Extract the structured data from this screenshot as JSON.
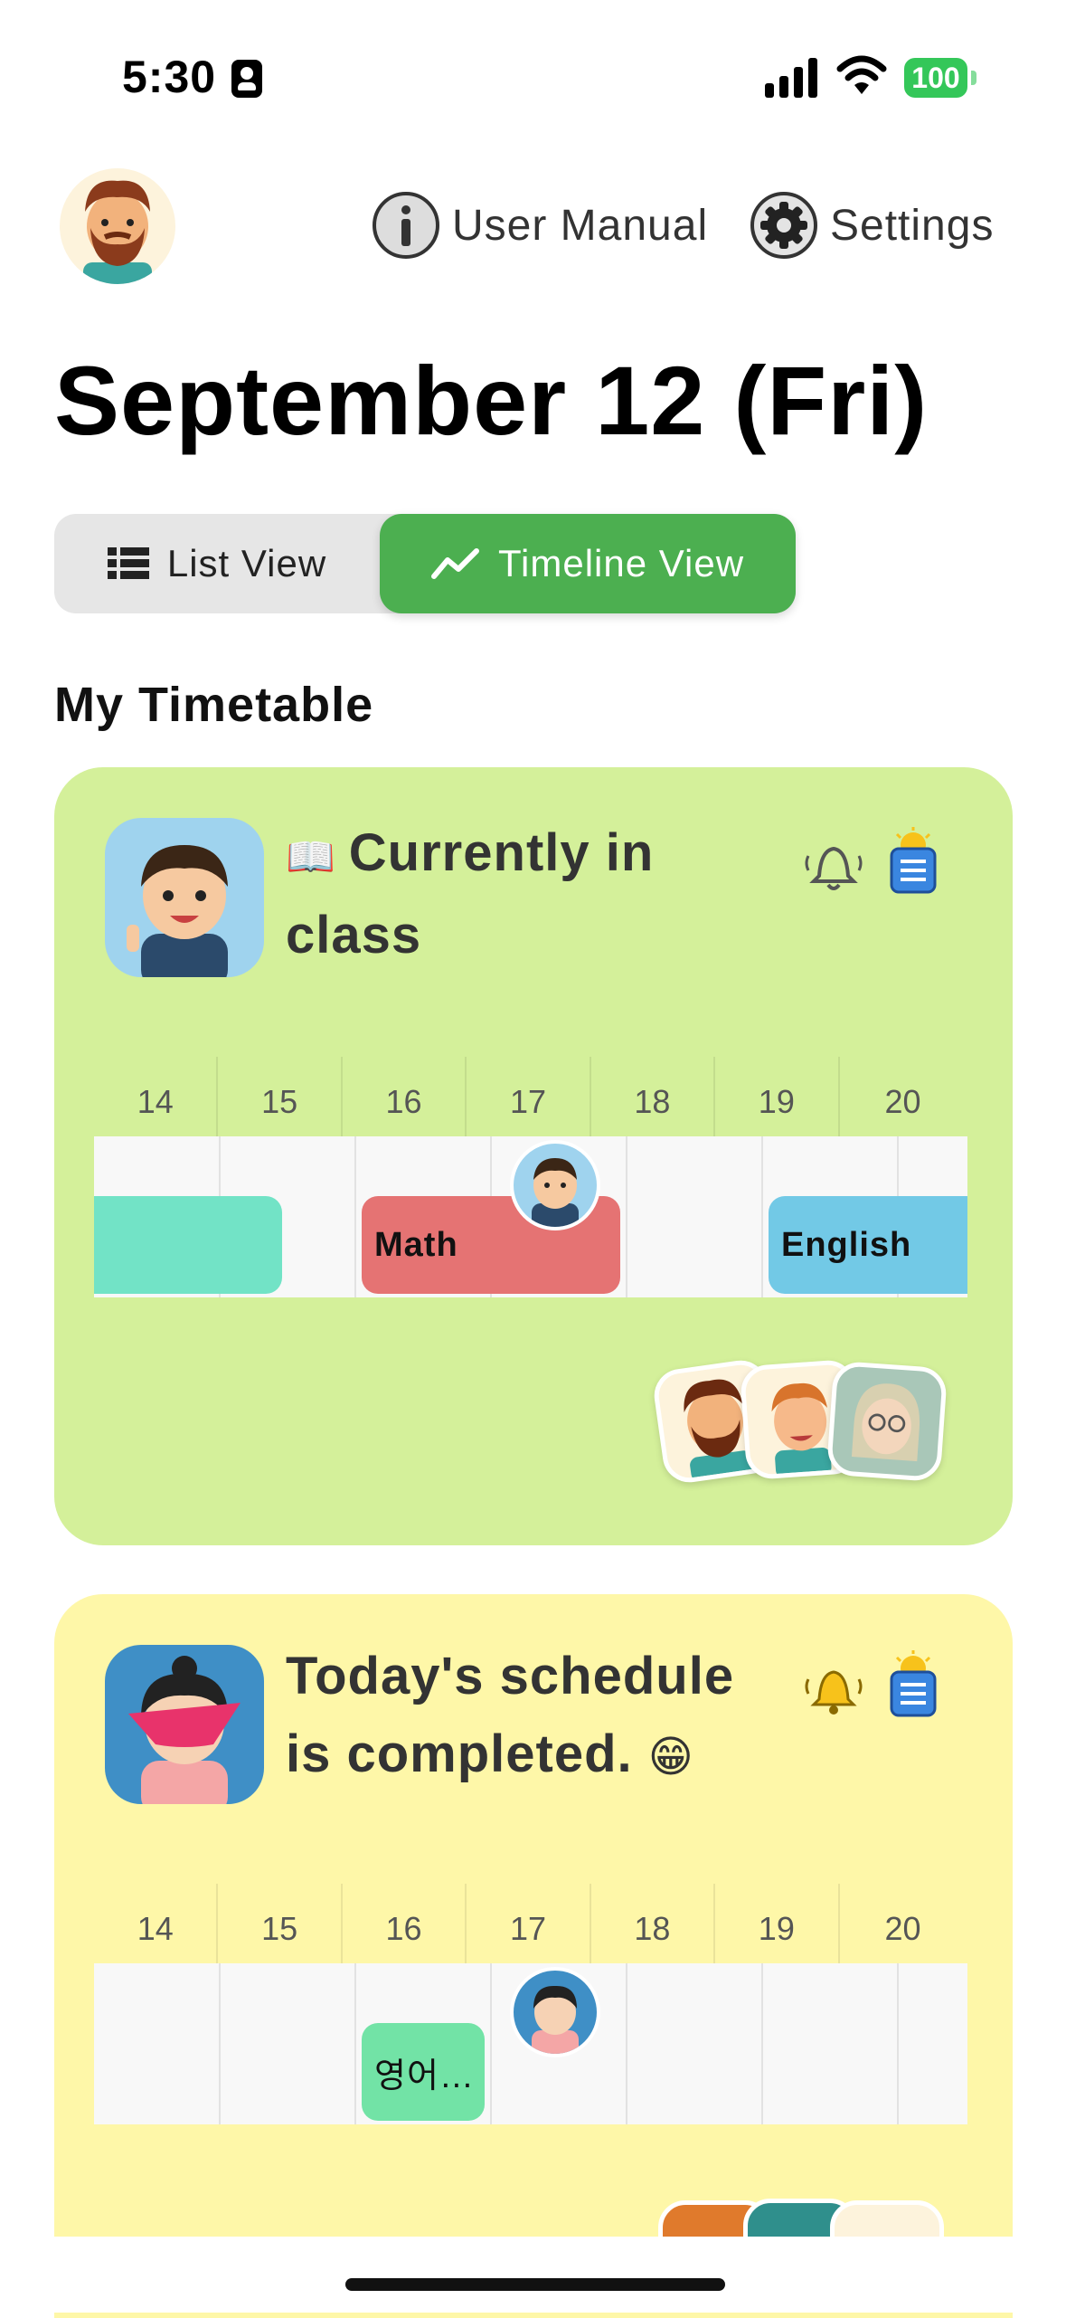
{
  "status_bar": {
    "time": "5:30",
    "battery": "100"
  },
  "header": {
    "manual_label": "User Manual",
    "settings_label": "Settings"
  },
  "date_title": "September 12 (Fri)",
  "view_toggle": {
    "list_label": "List View",
    "timeline_label": "Timeline View",
    "selected": "Timeline View"
  },
  "section_title": "My Timetable",
  "hours": [
    "14",
    "15",
    "16",
    "17",
    "18",
    "19",
    "20"
  ],
  "cards": [
    {
      "status_emoji": "📖",
      "status_text": "Currently in class",
      "background": "#d4f09a",
      "blocks": [
        {
          "label": "",
          "color": "#72e3c6"
        },
        {
          "label": "Math",
          "color": "#e57373"
        },
        {
          "label": "English",
          "color": "#72c9e6"
        }
      ]
    },
    {
      "status_text": "Today's schedule is completed.",
      "status_emoji": "😁",
      "background": "#fef7a8",
      "blocks": [
        {
          "label": "영어…",
          "color": "#72e3a6"
        }
      ]
    }
  ]
}
